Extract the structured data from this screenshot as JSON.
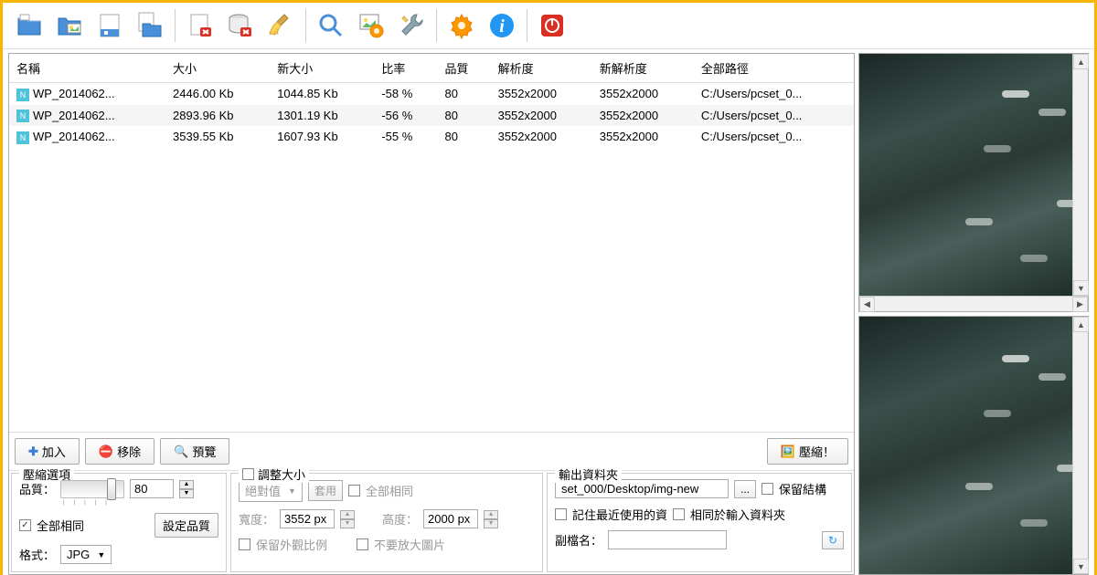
{
  "toolbar": {
    "icons": [
      "open-folder",
      "open-folder-photo",
      "save",
      "save-to-folder",
      "delete-file",
      "delete-drive",
      "clean-brush",
      "zoom",
      "image-settings",
      "tools-wrench",
      "settings-gear",
      "info",
      "power-off"
    ]
  },
  "table": {
    "columns": [
      "名稱",
      "大小",
      "新大小",
      "比率",
      "品質",
      "解析度",
      "新解析度",
      "全部路徑"
    ],
    "rows": [
      {
        "name": "WP_2014062...",
        "size": "2446.00 Kb",
        "newsize": "1044.85 Kb",
        "ratio": "-58 %",
        "quality": "80",
        "res": "3552x2000",
        "newres": "3552x2000",
        "path": "C:/Users/pcset_0..."
      },
      {
        "name": "WP_2014062...",
        "size": "2893.96 Kb",
        "newsize": "1301.19 Kb",
        "ratio": "-56 %",
        "quality": "80",
        "res": "3552x2000",
        "newres": "3552x2000",
        "path": "C:/Users/pcset_0..."
      },
      {
        "name": "WP_2014062...",
        "size": "3539.55 Kb",
        "newsize": "1607.93 Kb",
        "ratio": "-55 %",
        "quality": "80",
        "res": "3552x2000",
        "newres": "3552x2000",
        "path": "C:/Users/pcset_0..."
      }
    ]
  },
  "actions": {
    "add": "加入",
    "remove": "移除",
    "preview": "預覽",
    "compress": "壓縮！"
  },
  "compress_opts": {
    "title": "壓縮選項",
    "quality_label": "品質：",
    "quality_value": "80",
    "all_same": "全部相同",
    "set_quality": "設定品質",
    "format_label": "格式：",
    "format_value": "JPG"
  },
  "resize_opts": {
    "title": "調整大小",
    "mode": "絕對值",
    "apply": "套用",
    "all_same": "全部相同",
    "width_label": "寬度：",
    "width_value": "3552 px",
    "height_label": "高度：",
    "height_value": "2000 px",
    "keep_ratio": "保留外觀比例",
    "no_enlarge": "不要放大圖片"
  },
  "output_opts": {
    "title": "輸出資料夾",
    "folder_value": "set_000/Desktop/img-new",
    "browse": "...",
    "keep_structure": "保留結構",
    "remember_recent": "記住最近使用的資",
    "same_as_input": "相同於輸入資料夾",
    "suffix_label": "副檔名：",
    "suffix_value": ""
  }
}
